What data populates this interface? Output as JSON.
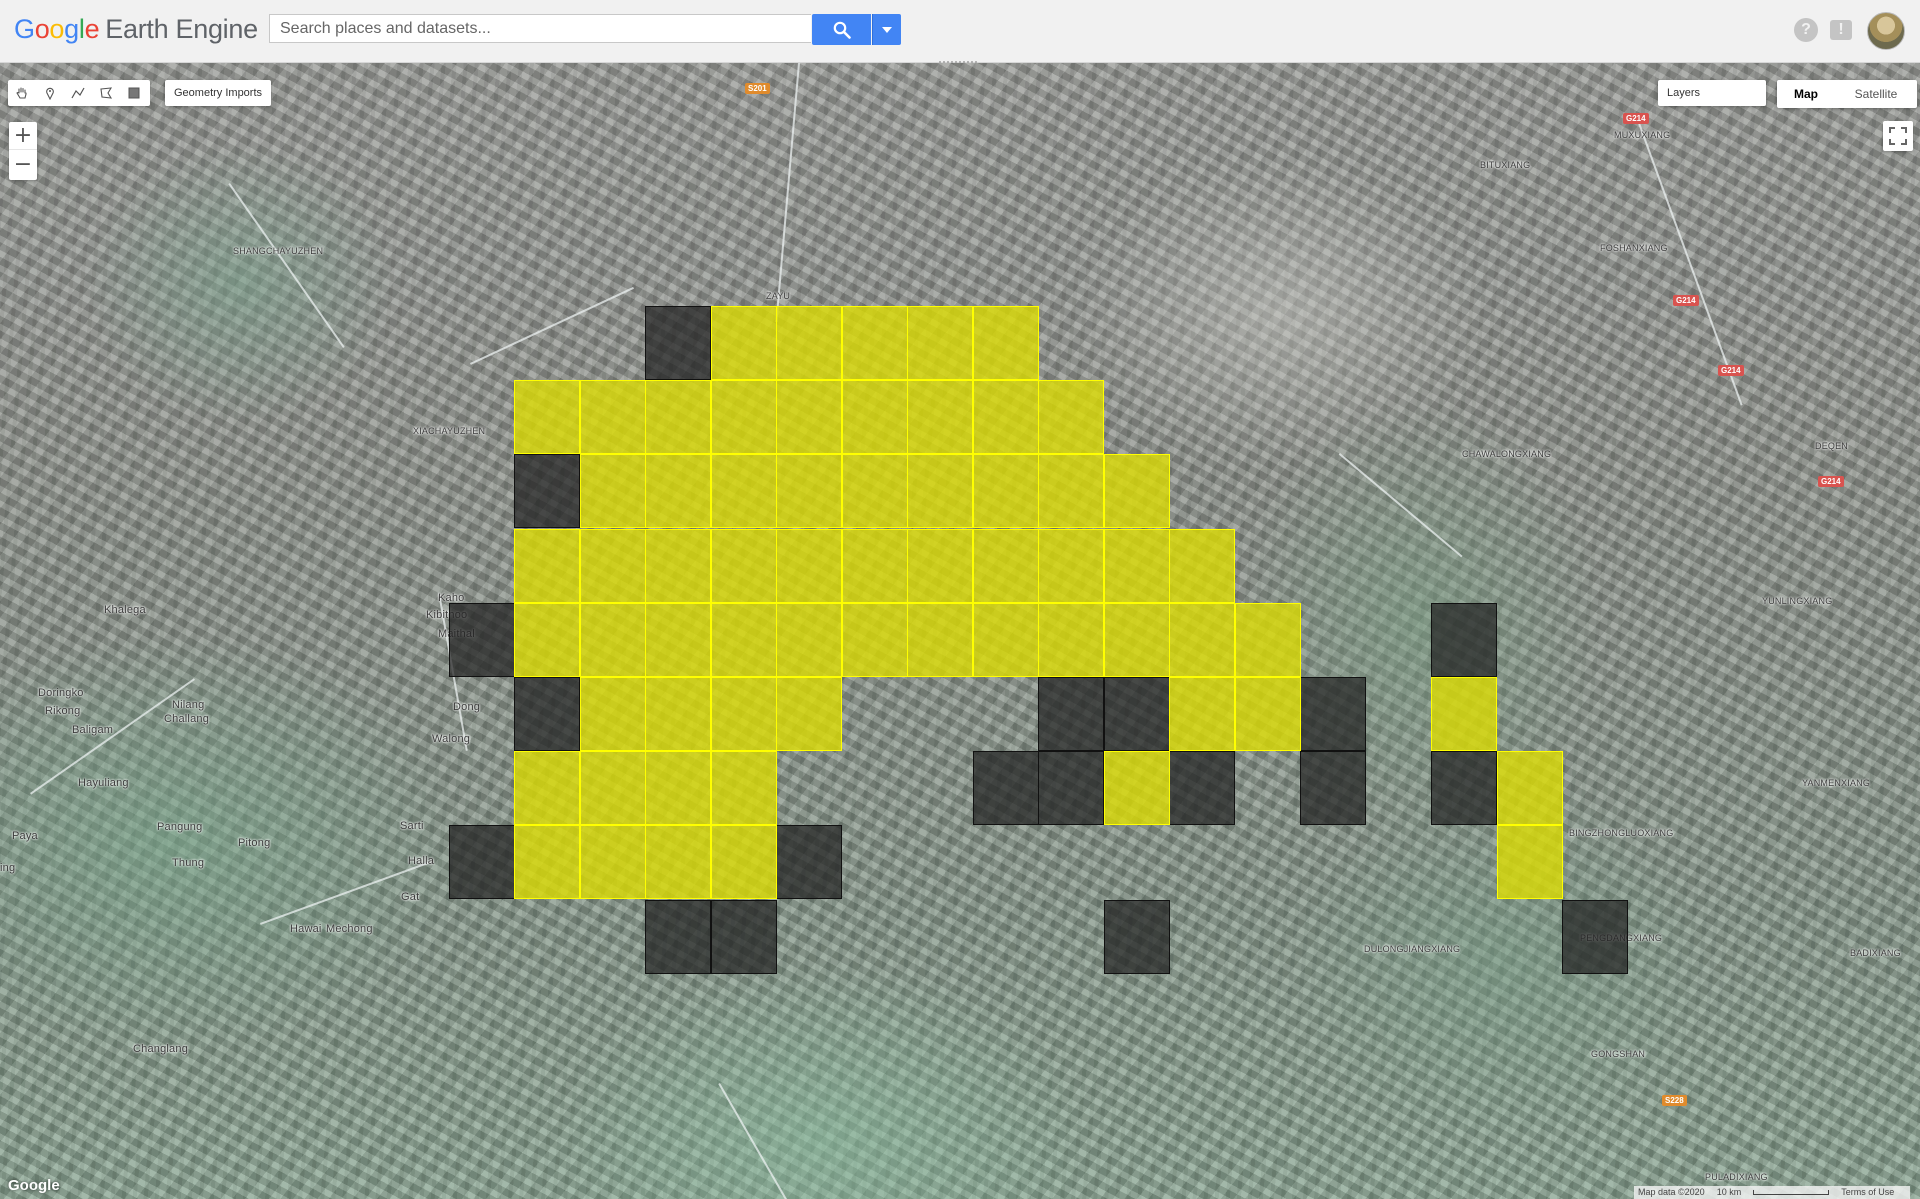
{
  "header": {
    "logo_google": [
      "G",
      "o",
      "o",
      "g",
      "l",
      "e"
    ],
    "logo_product": "Earth Engine",
    "search_placeholder": "Search places and datasets...",
    "help_glyph": "?",
    "feedback_glyph": "!"
  },
  "icons": {
    "pan": "hand-icon",
    "point": "marker-icon",
    "line": "polyline-icon",
    "polygon": "polygon-icon",
    "rectangle": "rectangle-icon",
    "search": "search-icon",
    "dropdown": "caret-down-icon",
    "fullscreen": "fullscreen-icon"
  },
  "map_controls": {
    "geometry_imports": "Geometry Imports",
    "zoom_in": "+",
    "zoom_out": "−",
    "layers": "Layers",
    "map_type_map": "Map",
    "map_type_satellite": "Satellite"
  },
  "place_labels": {
    "shangchayuzhen": "SHANGCHAYUZHEN",
    "xiachayuzhen": "XIACHAYUZHEN",
    "zayu": "ZAYU",
    "khalega": "Khalega",
    "doringko": "Doringko",
    "rikong": "Rikong",
    "baligam": "Baligam",
    "nilang": "Nilang",
    "challang": "Challang",
    "hayuliang": "Hayuliang",
    "paya": "Paya",
    "ing": "ing",
    "pangung": "Pangung",
    "thung": "Thung",
    "pitong": "Pitong",
    "hawai": "Hawai",
    "mechong": "Mechong",
    "changlang": "Changlang",
    "kaho": "Kaho",
    "kibithoo": "Kibithoo",
    "maithal": "Maithal",
    "dong": "Dong",
    "walong": "Walong",
    "sarti": "Sarti",
    "halla": "Halla",
    "gat": "Gat",
    "muxuxiang": "MUXUXIANG",
    "bituxiang": "BITUXIANG",
    "foshanxiang": "FOSHANXIANG",
    "chawalongxiang": "CHAWALONGXIANG",
    "deqen": "DEQEN",
    "yunlingxiang": "YUNLINGXIANG",
    "yanmenxiang": "YANMENXIANG",
    "bingzhongluoxiang": "BINGZHONGLUOXIANG",
    "dulongjiangxiang": "DULONGJIANGXIANG",
    "pengdangxiang": "PENGDANGXIANG",
    "badixiang": "BADIXIANG",
    "gongshan": "GONGSHAN",
    "puladixiang": "PULADIXIANG"
  },
  "road_shields": {
    "s201": "S201",
    "g214_a": "G214",
    "g214_b": "G214",
    "g214_c": "G214",
    "g214_d": "G214",
    "s228": "S228"
  },
  "colors": {
    "fill_class_a": "#dede00",
    "stroke_class_a": "#ffff00",
    "fill_class_b": "#232323",
    "stroke_class_b": "#111111",
    "search_button": "#4285f4"
  },
  "overlay_grid": {
    "yellow_cells": [
      [
        0,
        1
      ],
      [
        0,
        2
      ],
      [
        0,
        3
      ],
      [
        0,
        4
      ],
      [
        0,
        5
      ],
      [
        1,
        -2
      ],
      [
        1,
        -1
      ],
      [
        1,
        0
      ],
      [
        1,
        1
      ],
      [
        1,
        2
      ],
      [
        1,
        3
      ],
      [
        1,
        4
      ],
      [
        1,
        5
      ],
      [
        1,
        6
      ],
      [
        2,
        -1
      ],
      [
        2,
        0
      ],
      [
        2,
        1
      ],
      [
        2,
        2
      ],
      [
        2,
        3
      ],
      [
        2,
        4
      ],
      [
        2,
        5
      ],
      [
        2,
        6
      ],
      [
        2,
        7
      ],
      [
        3,
        -2
      ],
      [
        3,
        -1
      ],
      [
        3,
        0
      ],
      [
        3,
        1
      ],
      [
        3,
        2
      ],
      [
        3,
        3
      ],
      [
        3,
        4
      ],
      [
        3,
        5
      ],
      [
        3,
        6
      ],
      [
        3,
        7
      ],
      [
        3,
        8
      ],
      [
        4,
        -2
      ],
      [
        4,
        -1
      ],
      [
        4,
        0
      ],
      [
        4,
        1
      ],
      [
        4,
        2
      ],
      [
        4,
        3
      ],
      [
        4,
        4
      ],
      [
        4,
        5
      ],
      [
        4,
        6
      ],
      [
        4,
        7
      ],
      [
        4,
        8
      ],
      [
        4,
        9
      ],
      [
        5,
        -1
      ],
      [
        5,
        0
      ],
      [
        5,
        1
      ],
      [
        5,
        2
      ],
      [
        5,
        8
      ],
      [
        5,
        9
      ],
      [
        5,
        12
      ],
      [
        6,
        -2
      ],
      [
        6,
        -1
      ],
      [
        6,
        0
      ],
      [
        6,
        1
      ],
      [
        6,
        7
      ],
      [
        6,
        13
      ],
      [
        7,
        -2
      ],
      [
        7,
        -1
      ],
      [
        7,
        0
      ],
      [
        7,
        1
      ],
      [
        7,
        13
      ]
    ],
    "dark_cells": [
      [
        0,
        0
      ],
      [
        2,
        -2
      ],
      [
        4,
        -3
      ],
      [
        5,
        -2
      ],
      [
        5,
        6
      ],
      [
        5,
        7
      ],
      [
        5,
        10
      ],
      [
        6,
        5
      ],
      [
        6,
        6
      ],
      [
        6,
        8
      ],
      [
        6,
        10
      ],
      [
        6,
        12
      ],
      [
        4,
        12
      ],
      [
        7,
        -3
      ],
      [
        7,
        2
      ],
      [
        8,
        0
      ],
      [
        8,
        1
      ],
      [
        8,
        7
      ],
      [
        8,
        14
      ]
    ]
  },
  "attribution": {
    "map_data": "Map data ©2020",
    "scale": "10 km",
    "terms": "Terms of Use",
    "google": "Google"
  }
}
